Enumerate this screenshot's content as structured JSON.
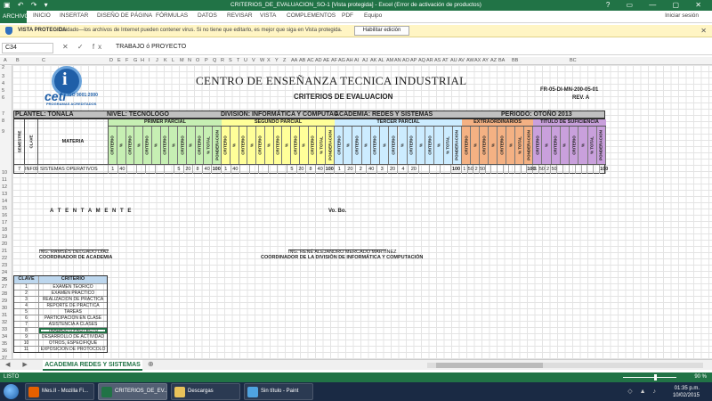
{
  "window": {
    "title": "CRITERIOS_DE_EVALUACION_SO-1  [Vista protegida] - Excel (Error de activación de productos)",
    "controls": "?   ▭   —   ▢   ✕"
  },
  "ribbon": {
    "file": "ARCHIVO",
    "tabs": [
      "INICIO",
      "INSERTAR",
      "DISEÑO DE PÁGINA",
      "FÓRMULAS",
      "DATOS",
      "REVISAR",
      "VISTA",
      "COMPLEMENTOS",
      "PDF",
      "Equipo"
    ],
    "signin": "Iniciar sesión"
  },
  "protected_view": {
    "label": "VISTA PROTEGIDA",
    "message": "Cuidado—los archivos de Internet pueden contener virus. Si no tiene que editarlo, es mejor que siga en Vista protegida.",
    "button": "Habilitar edición",
    "close": "✕"
  },
  "formula_bar": {
    "cell_ref": "C34",
    "fx": "✕ ✓ fx",
    "content": "TRABAJO ó  PROYECTO"
  },
  "columns": [
    "A",
    "B",
    "C",
    "D",
    "E",
    "F",
    "G",
    "H",
    "I",
    "J",
    "K",
    "L",
    "M",
    "N",
    "O",
    "P",
    "Q",
    "R",
    "S",
    "T",
    "U",
    "V",
    "W",
    "X",
    "Y",
    "Z",
    "AA",
    "AB",
    "AC",
    "AD",
    "AE",
    "AF",
    "AG",
    "AH",
    "AI",
    "AJ",
    "AK",
    "AL",
    "AM",
    "AN",
    "AO",
    "AP",
    "AQ",
    "AR",
    "AS",
    "AT",
    "AU",
    "AV",
    "AW",
    "AX",
    "AY",
    "AZ",
    "BA",
    "BB",
    "BC"
  ],
  "rows": [
    "2",
    "3",
    "4",
    "5",
    "6",
    "7",
    "8",
    "9",
    "10",
    "11",
    "12",
    "13",
    "14",
    "15",
    "16",
    "17",
    "18",
    "19",
    "20",
    "21",
    "22",
    "23",
    "24",
    "25",
    "26",
    "27",
    "28",
    "29",
    "30",
    "31",
    "32",
    "33",
    "34",
    "35",
    "36",
    "37",
    "38"
  ],
  "logo": {
    "brand": "ceti",
    "iso": "ISO 9001:2000",
    "programs": "PROGRAMAS ACREDITADOS"
  },
  "header": {
    "title": "CENTRO DE ENSEÑANZA TECNICA INDUSTRIAL",
    "subtitle": "CRITERIOS DE EVALUACION",
    "code": "FR-05-DI-MN-200-05-01",
    "rev": "REV. A"
  },
  "info_row": {
    "plantel": "PLANTEL: TONALA",
    "nivel": "NIVEL:  TECNOLOGO",
    "division": "DIVISION:  INFORMÁTICA Y COMPUTAC",
    "academia": "ACADEMIA:   REDES Y SISTEMAS",
    "periodo": "PERIODO:  OTOÑO 2013"
  },
  "table": {
    "semestre": "SEMESTRE",
    "clave": "CLAVE",
    "materia": "MATERIA",
    "bands": [
      {
        "label": "PRIMER PARCIAL",
        "color": "#c6efb3"
      },
      {
        "label": "SEGUNDO PARCIAL",
        "color": "#ffff99"
      },
      {
        "label": "TERCER PARCIAL",
        "color": "#ccecff"
      },
      {
        "label": "EXTRAORDINARIOS",
        "color": "#f4b183"
      },
      {
        "label": "TITULO DE SUFICIENCIA",
        "color": "#c9a0dc"
      }
    ],
    "vheaders": [
      "CRITERIO",
      "%",
      "CRITERIO",
      "%",
      "CRITERIO",
      "%",
      "CRITERIO",
      "%",
      "CRITERIO",
      "%",
      "CRITERIO",
      "%",
      "% TOTAL",
      "PONDERACION"
    ],
    "row": {
      "semestre": "7",
      "clave": "INF09",
      "materia": "SISTEMAS OPERATIVOS",
      "p1": [
        "1",
        "40",
        "",
        "",
        "",
        "",
        "",
        "5",
        "20",
        "8",
        "40",
        "100"
      ],
      "p2": [
        "1",
        "40",
        "",
        "",
        "",
        "",
        "",
        "5",
        "20",
        "8",
        "40",
        "100"
      ],
      "p3": [
        "1",
        "20",
        "2",
        "40",
        "3",
        "20",
        "4",
        "20",
        "",
        "",
        "",
        "100"
      ],
      "ex": [
        "1",
        "50",
        "2",
        "50",
        "",
        "",
        "",
        "",
        "",
        "",
        "",
        "100"
      ],
      "ts": [
        "1",
        "50",
        "2",
        "50",
        "",
        "",
        "",
        "",
        "",
        "",
        "",
        "100"
      ]
    }
  },
  "signatures": {
    "attention": "A T E N T A M E N T E",
    "vobo": "Vo. Bo.",
    "name1": "ING. RAMSÉS DELGADO DÍAZ",
    "role1": "COORDINADOR DE ACADEMIA",
    "name2": "ING. RENÉ ALEJANDRO MERCADO MARTÍNEZ",
    "role2": "COORDINADOR DE LA DIVISIÓN DE INFORMÁTICA Y COMPUTACIÓN"
  },
  "criteria": {
    "header_clave": "CLAVE",
    "header_criterio": "CRITERIO",
    "items": [
      {
        "clave": "1",
        "criterio": "EXAMEN TEORICO"
      },
      {
        "clave": "2",
        "criterio": "EXAMEN PRACTICO"
      },
      {
        "clave": "3",
        "criterio": "REALIZACION DE PRACTICA"
      },
      {
        "clave": "4",
        "criterio": "REPORTE DE PRACTICA"
      },
      {
        "clave": "5",
        "criterio": "TAREAS"
      },
      {
        "clave": "6",
        "criterio": "PARTICIPACION EN CLASE"
      },
      {
        "clave": "7",
        "criterio": "ASISTENCIA A CLASES"
      },
      {
        "clave": "8",
        "criterio": "TRABAJO ó  PROYECTO"
      },
      {
        "clave": "9",
        "criterio": "DESARROLLO DE ACTIVIDAD"
      },
      {
        "clave": "10",
        "criterio": "OTROS, ESPECIFIQUE"
      },
      {
        "clave": "11",
        "criterio": "EXPOSICION DE PROTOCOLO"
      }
    ]
  },
  "sheet_tabs": {
    "nav": "◀ ▶",
    "active": "ACADEMIA REDES Y SISTEMAS",
    "add": "⊕"
  },
  "status": {
    "ready": "LISTO",
    "zoom": "90 %"
  },
  "taskbar": {
    "items": [
      {
        "label": "Mes.II - Mozilla Fi...",
        "color": "#e66000"
      },
      {
        "label": "CRITERIOS_DE_EV...",
        "color": "#217346"
      },
      {
        "label": "Descargas",
        "color": "#e8c25a"
      },
      {
        "label": "Sin título - Paint",
        "color": "#4fa3e0"
      }
    ],
    "tray": "◇ ▲ ♪",
    "time": "01:35 p.m.",
    "date": "10/02/2015"
  },
  "colors": {
    "excel_green": "#217346",
    "selection_outline": "#217346",
    "info_bar": "#fff5c4"
  }
}
